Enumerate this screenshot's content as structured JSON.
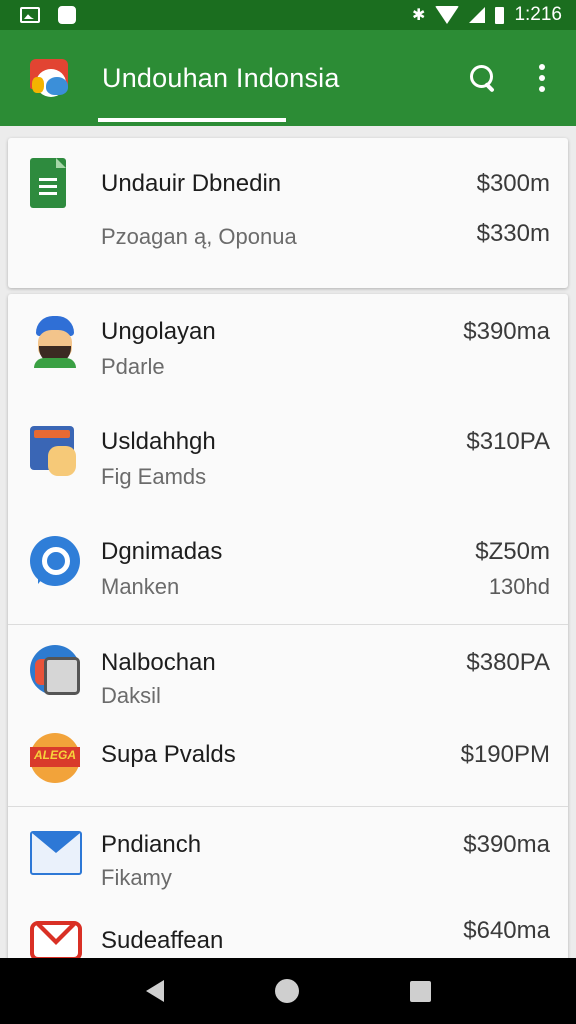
{
  "status_bar": {
    "time": "1:216"
  },
  "app_bar": {
    "title": "Undouhan Indonsia"
  },
  "top_card": {
    "title": "Undauir Dbnedin",
    "subtitle": "Pzoagan ą, Oponua",
    "price": "$300m",
    "price_secondary": "$330m"
  },
  "list": [
    {
      "icon": "face-avatar-icon",
      "title": "Ungolayan",
      "subtitle": "Pdarle",
      "price": "$390ma",
      "price_secondary": ""
    },
    {
      "icon": "hand-window-icon",
      "title": "Usldahhgh",
      "subtitle": "Fig Eamds",
      "price": "$310PA",
      "price_secondary": ""
    },
    {
      "icon": "map-pin-icon",
      "title": "Dgnimadas",
      "subtitle": "Manken",
      "price": "$Z50m",
      "price_secondary": "130hd"
    },
    {
      "icon": "device-icon",
      "title": "Nalbochan",
      "subtitle": "Daksil",
      "price": "$380PA",
      "price_secondary": ""
    },
    {
      "icon": "sale-badge-icon",
      "title": "Supa Pvalds",
      "subtitle": "",
      "price": "$190PM",
      "price_secondary": "",
      "badge_text": "ALEGA"
    },
    {
      "icon": "mail-icon",
      "title": "Pndianch",
      "subtitle": "Fikamy",
      "price": "$390ma",
      "price_secondary": ""
    },
    {
      "icon": "gmail-icon",
      "title": "Sudeaffean",
      "subtitle": "",
      "price": "$640ma",
      "price_secondary": ""
    }
  ],
  "colors": {
    "status_bar": "#1b6e1f",
    "app_bar": "#2c8c35",
    "nav_bar": "#000000"
  }
}
